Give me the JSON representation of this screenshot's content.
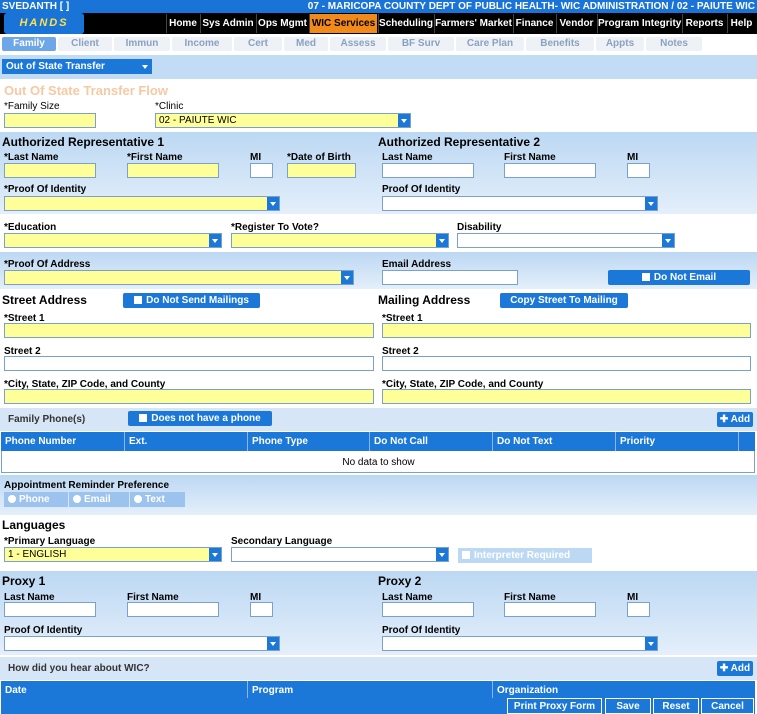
{
  "header": {
    "user": "SVEDANTH [ ]",
    "org": "07 - MARICOPA COUNTY DEPT OF PUBLIC HEALTH- WIC ADMINISTRATION / 02 - PAIUTE WIC",
    "logo": "HANDS"
  },
  "nav": [
    "Home",
    "Sys Admin",
    "Ops Mgmt",
    "WIC Services",
    "Scheduling",
    "Farmers' Market",
    "Finance",
    "Vendor",
    "Program Integrity",
    "Reports",
    "Help"
  ],
  "tabs": [
    "Family",
    "Client",
    "Immun",
    "Income",
    "Cert",
    "Med",
    "Assess",
    "BF Surv",
    "Care Plan",
    "Benefits",
    "Appts",
    "Notes"
  ],
  "flow_select": "Out of State Transfer",
  "flow_title": "Out Of State Transfer Flow",
  "family": {
    "size_label": "*Family Size",
    "clinic_label": "*Clinic",
    "clinic_value": "02 - PAIUTE WIC"
  },
  "rep1": {
    "title": "Authorized Representative 1",
    "last": "*Last Name",
    "first": "*First Name",
    "mi": "MI",
    "dob": "*Date of Birth",
    "proof": "*Proof Of Identity"
  },
  "rep2": {
    "title": "Authorized Representative 2",
    "last": "Last Name",
    "first": "First Name",
    "mi": "MI",
    "proof": "Proof Of Identity"
  },
  "demographics": {
    "education": "*Education",
    "vote": "*Register To Vote?",
    "disability": "Disability",
    "address_proof": "*Proof Of Address",
    "email": "Email Address",
    "no_email": "Do Not Email"
  },
  "street": {
    "title": "Street Address",
    "no_mail_btn": "Do Not Send Mailings",
    "s1": "*Street 1",
    "s2": "Street 2",
    "csz": "*City, State, ZIP Code, and County"
  },
  "mailing": {
    "title": "Mailing Address",
    "copy_btn": "Copy Street To Mailing",
    "s1": "*Street 1",
    "s2": "Street 2",
    "csz": "*City, State, ZIP Code, and County"
  },
  "phones": {
    "title": "Family Phone(s)",
    "no_phone_btn": "Does not have a phone",
    "add": "Add",
    "columns": [
      "Phone Number",
      "Ext.",
      "Phone Type",
      "Do Not Call",
      "Do Not Text",
      "Priority"
    ],
    "empty": "No data to show"
  },
  "reminder": {
    "title": "Appointment Reminder Preference",
    "options": [
      "Phone",
      "Email",
      "Text"
    ]
  },
  "languages": {
    "title": "Languages",
    "primary_label": "*Primary Language",
    "primary_value": "1 - ENGLISH",
    "secondary_label": "Secondary Language",
    "interpreter": "Interpreter Required"
  },
  "proxy1": {
    "title": "Proxy 1",
    "last": "Last Name",
    "first": "First Name",
    "mi": "MI",
    "proof": "Proof Of Identity"
  },
  "proxy2": {
    "title": "Proxy 2",
    "last": "Last Name",
    "first": "First Name",
    "mi": "MI",
    "proof": "Proof Of Identity"
  },
  "hear": {
    "title": "How did you hear about WIC?",
    "add": "Add",
    "columns": [
      "Date",
      "Program",
      "Organization"
    ]
  },
  "footer": [
    "Print Proxy Form",
    "Save",
    "Reset",
    "Cancel"
  ]
}
